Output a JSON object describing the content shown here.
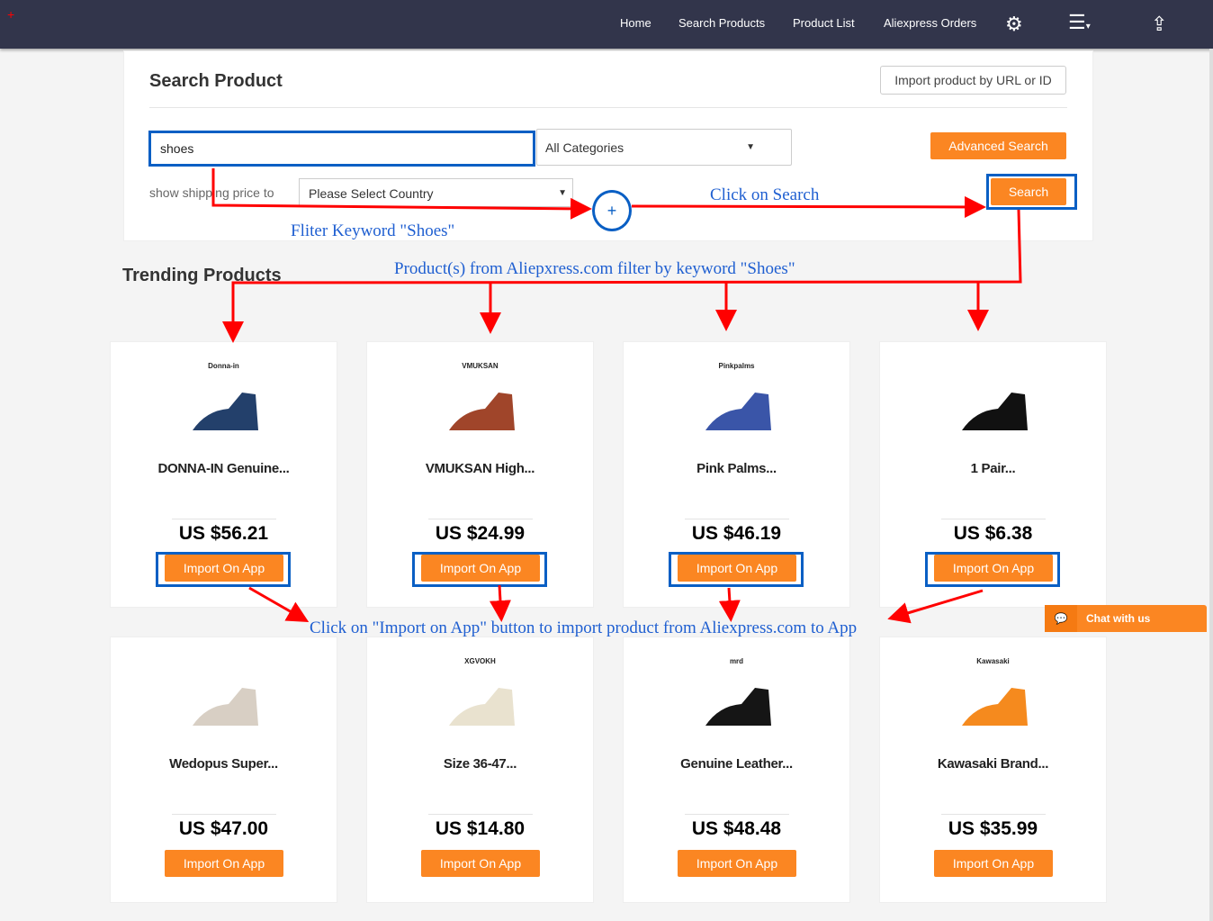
{
  "nav": {
    "links": [
      "Home",
      "Search Products",
      "Product List",
      "Aliexpress Orders"
    ],
    "icons": [
      "gear-icon",
      "menu-icon",
      "share-icon"
    ]
  },
  "search": {
    "title": "Search Product",
    "import_by_url": "Import product by URL or ID",
    "keyword": "shoes",
    "category": "All Categories",
    "advanced": "Advanced Search",
    "ship_label": "show shipping price to",
    "country": "Please Select Country",
    "search_btn": "Search"
  },
  "annotations": {
    "filter": "Fliter Keyword \"Shoes\"",
    "click_search": "Click on Search",
    "products": "Product(s) from Aliepxress.com filter by keyword \"Shoes\"",
    "import": "Click on \"Import on App\" button to import product from Aliexpress.com to App",
    "plus": "+"
  },
  "trending": "Trending Products",
  "products": [
    {
      "logo": "Donna-in",
      "name": "DONNA-IN Genuine...",
      "price": "US $56.21",
      "btn": "Import On App",
      "color": "#23406b"
    },
    {
      "logo": "VMUKSAN",
      "name": "VMUKSAN High...",
      "price": "US $24.99",
      "btn": "Import On App",
      "color": "#a0452a"
    },
    {
      "logo": "Pinkpalms",
      "name": "Pink Palms...",
      "price": "US $46.19",
      "btn": "Import On App",
      "color": "#3a55a8"
    },
    {
      "logo": "",
      "name": "1 Pair...",
      "price": "US $6.38",
      "btn": "Import On App",
      "color": "#111111"
    },
    {
      "logo": "",
      "name": "Wedopus Super...",
      "price": "US $47.00",
      "btn": "Import On App",
      "color": "#d8cfc4"
    },
    {
      "logo": "XGVOKH",
      "name": "Size 36-47...",
      "price": "US $14.80",
      "btn": "Import On App",
      "color": "#e9e2cf"
    },
    {
      "logo": "mrd",
      "name": "Genuine Leather...",
      "price": "US $48.48",
      "btn": "Import On App",
      "color": "#151515"
    },
    {
      "logo": "Kawasaki",
      "name": "Kawasaki Brand...",
      "price": "US $35.99",
      "btn": "Import On App",
      "color": "#f58a1e"
    }
  ],
  "chat": "Chat with us",
  "colors": {
    "nav": "#32354b",
    "accent": "#fb8622",
    "highlight": "#0a5fc4",
    "arrow": "#ff0000"
  }
}
